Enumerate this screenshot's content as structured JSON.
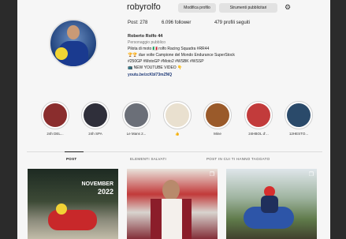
{
  "profile": {
    "username": "robyrolfo",
    "edit_button": "Modifica profilo",
    "tools_button": "Strumenti pubblicitari",
    "stats": {
      "posts": "Post: 278",
      "followers": "6.096 follower",
      "following": "479 profili seguiti"
    },
    "bio": {
      "name": "Roberto Rolfo 44",
      "category": "Personaggio pubblico",
      "line1": "Pilota di moto 🇮🇹 rolfo Racing Squadra #RR44",
      "line2": "🏆🏆 due volte Campione del Mondo Endurance SuperStock",
      "line3": "#250GP #MotoGP #Moto2 #WSBK #WSSP",
      "line4": "📺 NEW YOUTUBE VIDEO 👇",
      "link": "youtu.be/zcKbI73mZNQ"
    }
  },
  "highlights": [
    {
      "label": "24h DEL...",
      "color": "#8a2d2d"
    },
    {
      "label": "24h SPA",
      "color": "#2f2f3a"
    },
    {
      "label": "Le Mans 2...",
      "color": "#6b6f78"
    },
    {
      "label": "👍",
      "color": "#e9e0cf"
    },
    {
      "label": "Mine",
      "color": "#9a5a2a"
    },
    {
      "label": "24HBOL d'...",
      "color": "#c23b3b"
    },
    {
      "label": "12HESTO...",
      "color": "#2a4a6a"
    }
  ],
  "tabs": {
    "posts": "POST",
    "saved": "ELEMENTI SALVATI",
    "tagged": "POST IN CUI TI HANNO TAGGATO"
  },
  "posts": [
    {
      "badge_line1": "NOVEMBER",
      "badge_line2": "2022",
      "icon": "carousel-icon"
    },
    {
      "icon": "carousel-icon"
    },
    {
      "icon": "carousel-icon"
    }
  ],
  "colors": {
    "accent": "#1f3a78",
    "background": "#f6f6f6",
    "button": "#e2e2e2"
  }
}
